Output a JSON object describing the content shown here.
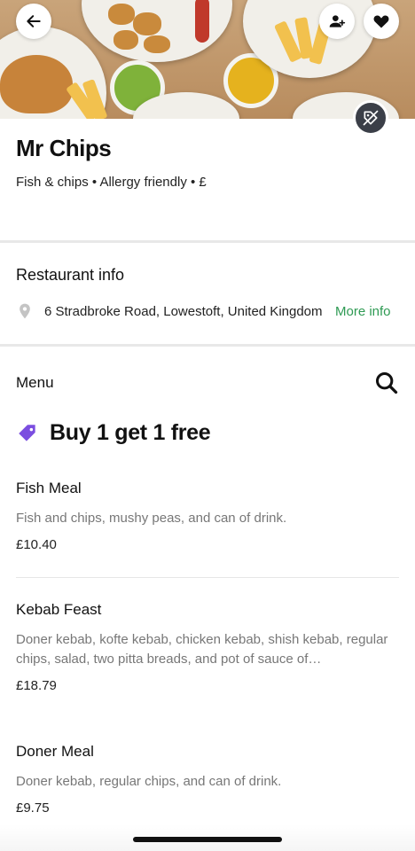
{
  "restaurant": {
    "name": "Mr Chips",
    "tags": "Fish & chips • Allergy friendly • £"
  },
  "info": {
    "heading": "Restaurant info",
    "address": "6 Stradbroke Road, Lowestoft, United Kingdom",
    "more_link": "More info"
  },
  "menu": {
    "label": "Menu",
    "promo": "Buy 1 get 1 free",
    "items": [
      {
        "name": "Fish Meal",
        "description": "Fish and chips, mushy peas, and can of drink.",
        "price": "£10.40"
      },
      {
        "name": "Kebab Feast",
        "description": "Doner kebab, kofte kebab, chicken kebab, shish kebab, regular chips, salad, two pitta breads, and pot of sauce of…",
        "price": "£18.79"
      },
      {
        "name": "Doner Meal",
        "description": "Doner kebab, regular chips, and can of drink.",
        "price": "£9.75"
      }
    ]
  },
  "icons": {
    "back": "arrow-left-icon",
    "group_order": "add-person-icon",
    "favorite": "heart-icon",
    "location": "map-pin-icon",
    "search": "search-icon",
    "promo": "tag-icon"
  },
  "colors": {
    "accent_green": "#2e9a53",
    "promo_purple": "#7b4ee0"
  }
}
